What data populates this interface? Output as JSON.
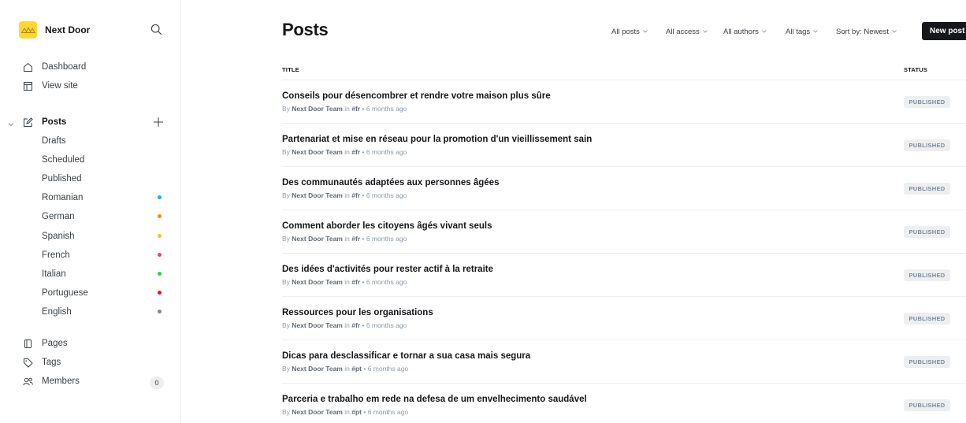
{
  "sidebar": {
    "brand": "Next Door",
    "nav_top": [
      {
        "label": "Dashboard",
        "icon": "home-icon"
      },
      {
        "label": "View site",
        "icon": "layout-icon"
      }
    ],
    "posts_label": "Posts",
    "post_filters": [
      {
        "label": "Drafts"
      },
      {
        "label": "Scheduled"
      },
      {
        "label": "Published"
      },
      {
        "label": "Romanian",
        "color": "#2aa9f2"
      },
      {
        "label": "German",
        "color": "#fb8c00"
      },
      {
        "label": "Spanish",
        "color": "#fbc02d"
      },
      {
        "label": "French",
        "color": "#f0368a"
      },
      {
        "label": "Italian",
        "color": "#30cf43"
      },
      {
        "label": "Portuguese",
        "color": "#f50b23"
      },
      {
        "label": "English",
        "color": "#7c8b9a"
      }
    ],
    "nav_bottom": [
      {
        "label": "Pages",
        "icon": "page-icon"
      },
      {
        "label": "Tags",
        "icon": "tag-icon"
      },
      {
        "label": "Members",
        "icon": "members-icon",
        "count": "0"
      }
    ]
  },
  "header": {
    "title": "Posts",
    "filters": [
      "All posts",
      "All access",
      "All authors",
      "All tags",
      "Sort by: Newest"
    ],
    "new_post": "New post"
  },
  "table": {
    "col_title": "TITLE",
    "col_status": "STATUS",
    "rows": [
      {
        "title": "Conseils pour désencombrer et rendre votre maison plus sûre",
        "by": "By",
        "author": "Next Door Team",
        "in": "in",
        "tag": "#fr",
        "when": "• 6 months ago",
        "status": "PUBLISHED"
      },
      {
        "title": "Partenariat et mise en réseau pour la promotion d'un vieillissement sain",
        "by": "By",
        "author": "Next Door Team",
        "in": "in",
        "tag": "#fr",
        "when": "• 6 months ago",
        "status": "PUBLISHED"
      },
      {
        "title": "Des communautés adaptées aux personnes âgées",
        "by": "By",
        "author": "Next Door Team",
        "in": "in",
        "tag": "#fr",
        "when": "• 6 months ago",
        "status": "PUBLISHED"
      },
      {
        "title": "Comment aborder les citoyens âgés vivant seuls",
        "by": "By",
        "author": "Next Door Team",
        "in": "in",
        "tag": "#fr",
        "when": "• 6 months ago",
        "status": "PUBLISHED"
      },
      {
        "title": "Des idées d'activités pour rester actif à la retraite",
        "by": "By",
        "author": "Next Door Team",
        "in": "in",
        "tag": "#fr",
        "when": "• 6 months ago",
        "status": "PUBLISHED"
      },
      {
        "title": "Ressources pour les organisations",
        "by": "By",
        "author": "Next Door Team",
        "in": "in",
        "tag": "#fr",
        "when": "• 6 months ago",
        "status": "PUBLISHED"
      },
      {
        "title": "Dicas para desclassificar e tornar a sua casa mais segura",
        "by": "By",
        "author": "Next Door Team",
        "in": "in",
        "tag": "#pt",
        "when": "• 6 months ago",
        "status": "PUBLISHED"
      },
      {
        "title": "Parceria e trabalho em rede na defesa de um envelhecimento saudável",
        "by": "By",
        "author": "Next Door Team",
        "in": "in",
        "tag": "#pt",
        "when": "• 6 months ago",
        "status": "PUBLISHED"
      }
    ]
  }
}
